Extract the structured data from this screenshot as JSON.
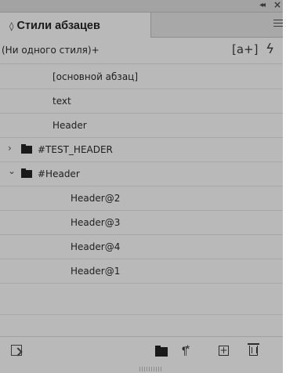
{
  "panel": {
    "tab_arrows": "◊",
    "title": "Стили абзацев",
    "collapse_icon": "double-chevron-left-icon",
    "close_icon": "close-icon",
    "menu_icon": "hamburger-menu-icon"
  },
  "current_style": {
    "label": "(Ни одного стиля)+",
    "new_style_glyph": "[a+]",
    "quick_apply_glyph": "ϟ"
  },
  "styles": [
    {
      "label": "[основной абзац]",
      "indent": 1
    },
    {
      "label": "text",
      "indent": 1
    },
    {
      "label": "Header",
      "indent": 1
    }
  ],
  "groups": [
    {
      "label": "#TEST_HEADER",
      "expanded": false,
      "chevron": "›"
    },
    {
      "label": "#Header",
      "expanded": true,
      "chevron": "⌄",
      "children": [
        "Header@2",
        "Header@3",
        "Header@4",
        "Header@1"
      ]
    }
  ],
  "bottom_icons": {
    "load": "load-styles-icon",
    "group": "new-group-icon",
    "clear": "¶⃰",
    "add": "+",
    "delete": "trash-icon"
  }
}
